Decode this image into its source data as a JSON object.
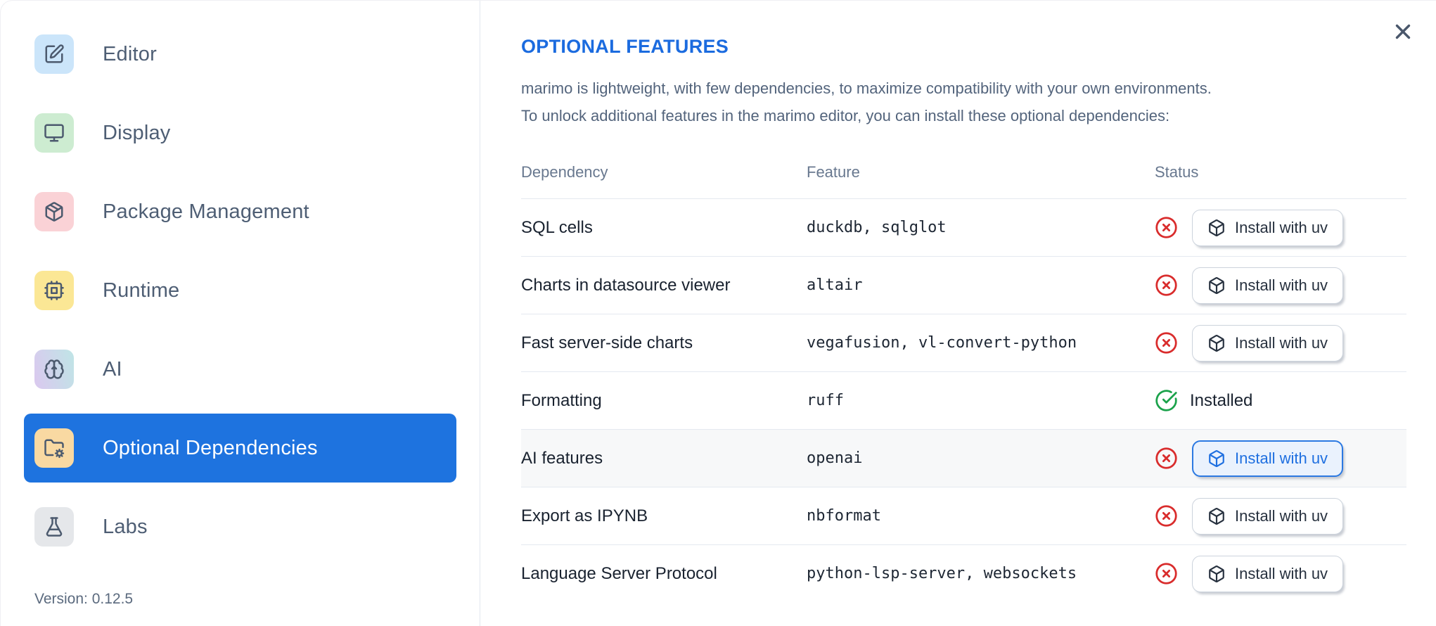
{
  "dialog": {
    "close_icon": "x-icon"
  },
  "sidebar": {
    "items": [
      {
        "label": "Editor",
        "icon": "square-pen-icon",
        "icon_bg": "#cbe5fa",
        "selected": false
      },
      {
        "label": "Display",
        "icon": "monitor-icon",
        "icon_bg": "#cdecd1",
        "selected": false
      },
      {
        "label": "Package Management",
        "icon": "package-icon",
        "icon_bg": "#fad2d6",
        "selected": false
      },
      {
        "label": "Runtime",
        "icon": "cpu-icon",
        "icon_bg": "#fbe795",
        "selected": false
      },
      {
        "label": "AI",
        "icon": "brain-icon",
        "icon_bg": "linear-gradient(75deg,#dbc8ef,#bfe5e6)",
        "selected": false
      },
      {
        "label": "Optional Dependencies",
        "icon": "folder-cog-icon",
        "icon_bg": "#f9d9a2",
        "selected": true
      },
      {
        "label": "Labs",
        "icon": "flask-icon",
        "icon_bg": "#e5e7ea",
        "selected": false
      }
    ],
    "version": "Version: 0.12.5"
  },
  "main": {
    "title": "OPTIONAL FEATURES",
    "description_lines": [
      "marimo is lightweight, with few dependencies, to maximize compatibility with your own environments.",
      "To unlock additional features in the marimo editor, you can install these optional dependencies:"
    ],
    "table": {
      "headers": [
        "Dependency",
        "Feature",
        "Status"
      ],
      "install_button_label": "Install with uv",
      "install_button_icon": "package-box-icon",
      "not_installed_icon": "circle-x-icon",
      "installed_icon": "circle-check-icon",
      "installed_label": "Installed",
      "rows": [
        {
          "dependency": "SQL cells",
          "feature": "duckdb, sqlglot",
          "installed": false,
          "highlighted": false
        },
        {
          "dependency": "Charts in datasource viewer",
          "feature": "altair",
          "installed": false,
          "highlighted": false
        },
        {
          "dependency": "Fast server-side charts",
          "feature": "vegafusion, vl-convert-python",
          "installed": false,
          "highlighted": false
        },
        {
          "dependency": "Formatting",
          "feature": "ruff",
          "installed": true,
          "highlighted": false
        },
        {
          "dependency": "AI features",
          "feature": "openai",
          "installed": false,
          "highlighted": true
        },
        {
          "dependency": "Export as IPYNB",
          "feature": "nbformat",
          "installed": false,
          "highlighted": false
        },
        {
          "dependency": "Language Server Protocol",
          "feature": "python-lsp-server, websockets",
          "installed": false,
          "highlighted": false
        }
      ]
    }
  },
  "colors": {
    "selection_blue": "#1e73df",
    "heading_blue": "#1b6bdf",
    "focus_blue": "#2b79e2",
    "focus_bg": "#eaf2fd",
    "error_red": "#d92c2c",
    "success_green": "#1ba24b",
    "divider": "#e2e7ee",
    "row_highlight": "#f7f8f9"
  }
}
